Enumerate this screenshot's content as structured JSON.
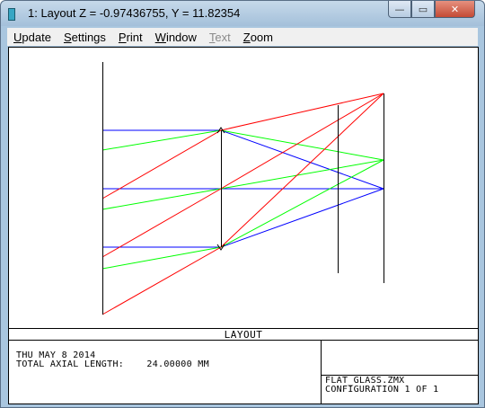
{
  "window": {
    "title": "1: Layout Z = -0.97436755, Y = 11.82354",
    "minimize_glyph": "—",
    "maximize_glyph": "▭",
    "close_glyph": "✕"
  },
  "menu": {
    "items": [
      {
        "access_key": "U",
        "rest": "pdate",
        "enabled": true
      },
      {
        "access_key": "S",
        "rest": "ettings",
        "enabled": true
      },
      {
        "access_key": "P",
        "rest": "rint",
        "enabled": true
      },
      {
        "access_key": "W",
        "rest": "indow",
        "enabled": true
      },
      {
        "access_key": "T",
        "rest": "ext",
        "enabled": false
      },
      {
        "access_key": "Z",
        "rest": "oom",
        "enabled": true
      }
    ]
  },
  "plot": {
    "section_label": "LAYOUT",
    "date_line": "THU MAY 8 2014",
    "length_line": "TOTAL AXIAL LENGTH:    24.00000 MM",
    "file_name": "FLAT_GLASS.ZMX",
    "configuration": "CONFIGURATION 1 OF 1",
    "colors": {
      "blue": "#0000ff",
      "green": "#00ff00",
      "red": "#ff0000",
      "frame": "#000000"
    }
  }
}
